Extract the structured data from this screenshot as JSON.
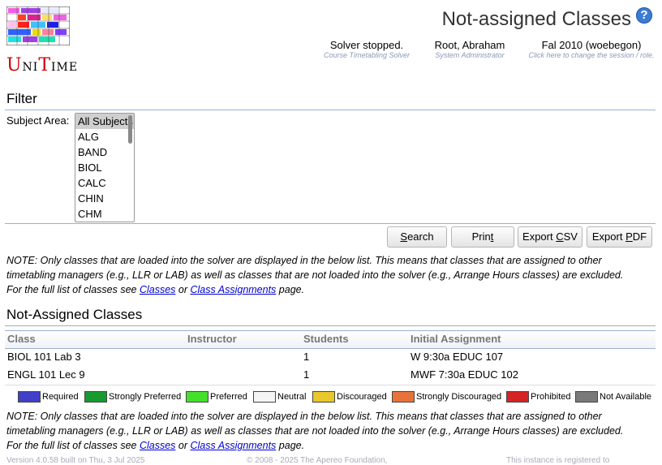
{
  "brand": {
    "name_first": "U",
    "name_rest1": "NI",
    "name_t": "T",
    "name_rest2": "IME"
  },
  "header": {
    "title": "Not-assigned Classes",
    "help": "?",
    "solver": {
      "main": "Solver stopped.",
      "sub": "Course Timetabling Solver"
    },
    "user": {
      "main": "Root, Abraham",
      "sub": "System Administrator"
    },
    "session": {
      "main": "Fal 2010 (woebegon)",
      "sub": "Click here to change the session / role."
    }
  },
  "filter": {
    "title": "Filter",
    "subject_label": "Subject Area:",
    "subjects": [
      "All Subjects",
      "ALG",
      "BAND",
      "BIOL",
      "CALC",
      "CHIN",
      "CHM"
    ],
    "selected": "All Subjects"
  },
  "buttons": {
    "search": {
      "pre": "",
      "key": "S",
      "post": "earch"
    },
    "print": {
      "pre": "Prin",
      "key": "t",
      "post": ""
    },
    "export_csv": {
      "pre": "Export ",
      "key": "C",
      "post": "SV"
    },
    "export_pdf": {
      "pre": "Export ",
      "key": "P",
      "post": "DF"
    }
  },
  "note": {
    "line1": "NOTE: Only classes that are loaded into the solver are displayed in the below list. This means that classes that are assigned to other",
    "line2": "timetabling managers (e.g., LLR or LAB) as well as classes that are not loaded into the solver (e.g., Arrange Hours classes) are excluded.",
    "line3_pre": "For the full list of classes see ",
    "link1": "Classes",
    "line3_mid": " or ",
    "link2": "Class Assignments",
    "line3_post": " page."
  },
  "results": {
    "title": "Not-Assigned Classes",
    "columns": [
      "Class",
      "Instructor",
      "Students",
      "Initial Assignment"
    ],
    "rows": [
      {
        "class": "BIOL 101 Lab 3",
        "instructor": "",
        "students": "1",
        "assignment": "W 9:30a EDUC 107"
      },
      {
        "class": "ENGL 101 Lec 9",
        "instructor": "",
        "students": "1",
        "assignment": "MWF 7:30a EDUC 102"
      }
    ]
  },
  "legend": [
    {
      "label": "Required",
      "color": "#4040c8"
    },
    {
      "label": "Strongly Preferred",
      "color": "#189a30"
    },
    {
      "label": "Preferred",
      "color": "#44e02c"
    },
    {
      "label": "Neutral",
      "color": "#f5f5f5"
    },
    {
      "label": "Discouraged",
      "color": "#e8c82a"
    },
    {
      "label": "Strongly Discouraged",
      "color": "#e8733a"
    },
    {
      "label": "Prohibited",
      "color": "#d42424"
    },
    {
      "label": "Not Available",
      "color": "#7a7a7a"
    }
  ],
  "footer": {
    "version": "Version 4.0.58 built on Thu, 3 Jul 2025",
    "copyright": "© 2008 - 2025 The Apereo Foundation,",
    "notice": "This instance is registered to"
  }
}
